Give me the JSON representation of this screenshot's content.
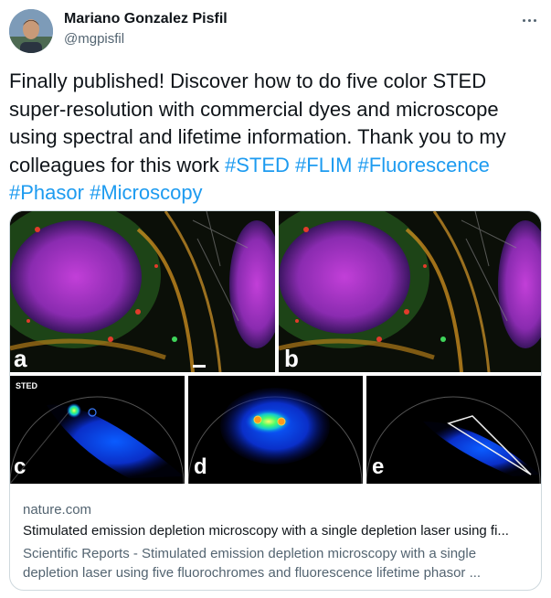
{
  "author": {
    "name": "Mariano Gonzalez Pisfil",
    "handle": "@mgpisfil",
    "avatar_icon": "user-avatar-photo"
  },
  "menu": {
    "icon": "more-horizontal-icon"
  },
  "tweet": {
    "text_parts": [
      {
        "text": "Finally published! Discover how to do five color STED super-resolution with commercial dyes and microscope using spectral and lifetime information. Thank you to my colleagues for this work ",
        "hashtag": false
      },
      {
        "text": "#STED",
        "hashtag": true
      },
      {
        "text": " ",
        "hashtag": false
      },
      {
        "text": "#FLIM",
        "hashtag": true
      },
      {
        "text": " ",
        "hashtag": false
      },
      {
        "text": "#Fluorescence",
        "hashtag": true
      },
      {
        "text": " ",
        "hashtag": false
      },
      {
        "text": "#Phasor",
        "hashtag": true
      },
      {
        "text": " ",
        "hashtag": false
      },
      {
        "text": "#Microscopy",
        "hashtag": true
      }
    ],
    "hashtag_color": "#1d9bf0"
  },
  "card": {
    "panel_letters": {
      "a": "a",
      "b": "b",
      "c": "c",
      "d": "d",
      "e": "e"
    },
    "panel_c_label": "STED",
    "domain": "nature.com",
    "title": "Stimulated emission depletion microscopy with a single depletion laser using fi...",
    "description": "Scientific Reports - Stimulated emission depletion microscopy with a single depletion laser using five fluorochromes and fluorescence lifetime phasor ..."
  }
}
